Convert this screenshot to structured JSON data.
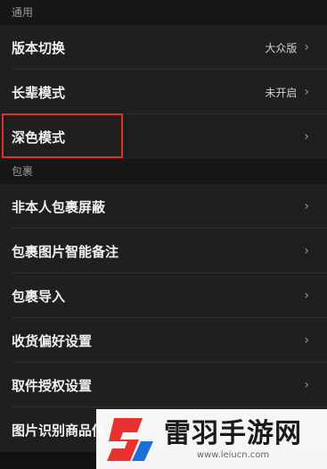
{
  "sections": [
    {
      "title": "通用",
      "items": [
        {
          "label": "版本切换",
          "value": "大众版"
        },
        {
          "label": "长辈模式",
          "value": "未开启"
        },
        {
          "label": "深色模式",
          "value": ""
        }
      ]
    },
    {
      "title": "包裹",
      "items": [
        {
          "label": "非本人包裹屏蔽",
          "value": ""
        },
        {
          "label": "包裹图片智能备注",
          "value": ""
        },
        {
          "label": "包裹导入",
          "value": ""
        },
        {
          "label": "收货偏好设置",
          "value": ""
        },
        {
          "label": "取件授权设置",
          "value": ""
        },
        {
          "label": "图片识别商品信",
          "value": ""
        }
      ]
    }
  ],
  "chevron": "›",
  "watermark": {
    "title": "雷羽手游网",
    "url": "www.leiucn.com"
  },
  "colors": {
    "highlight": "#e0302c",
    "background": "#121212",
    "row": "#1f1f1f",
    "logo_red": "#e8322f",
    "logo_blue": "#1e6fd9"
  }
}
